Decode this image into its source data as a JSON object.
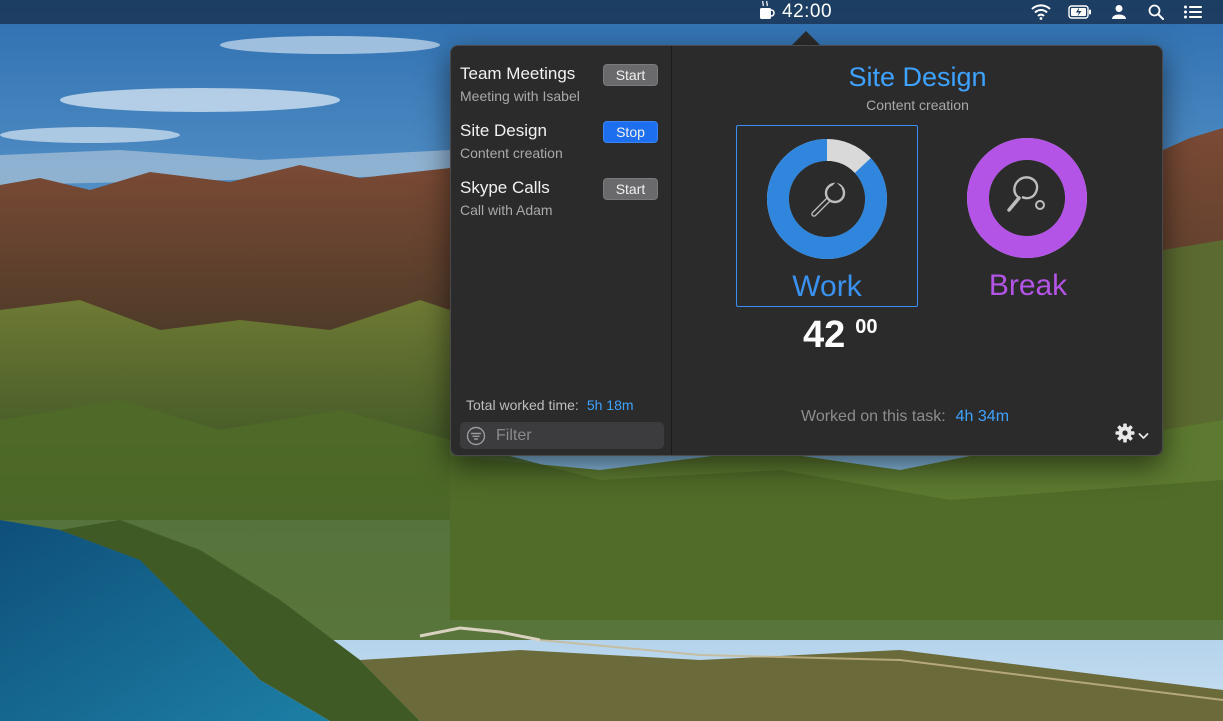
{
  "menubar": {
    "timer": "42:00",
    "icons": [
      "coffee-cup-icon",
      "wifi-icon",
      "battery-icon",
      "user-icon",
      "search-icon",
      "control-center-icon"
    ]
  },
  "tasks": [
    {
      "name": "Team Meetings",
      "description": "Meeting with Isabel",
      "button": "Start",
      "active": false
    },
    {
      "name": "Site Design",
      "description": "Content creation",
      "button": "Stop",
      "active": true
    },
    {
      "name": "Skype Calls",
      "description": "Call with Adam",
      "button": "Start",
      "active": false
    }
  ],
  "footer": {
    "total_label": "Total worked time:",
    "total_value": "5h 18m",
    "filter_placeholder": "Filter"
  },
  "current": {
    "title": "Site Design",
    "subtitle": "Content creation",
    "modes": {
      "work": {
        "label": "Work",
        "progress": 0.87,
        "color": "#2f86dc",
        "icon": "wrench-icon"
      },
      "break": {
        "label": "Break",
        "progress": 1.0,
        "color": "#b354e6",
        "icon": "ping-pong-icon"
      }
    },
    "timer_minutes": "42",
    "timer_seconds": "00",
    "worked_label": "Worked on this task:",
    "worked_value": "4h 34m"
  },
  "colors": {
    "accent": "#3ea2ff",
    "stop_button": "#1e6ff0",
    "work": "#2f86dc",
    "break": "#b354e6"
  }
}
